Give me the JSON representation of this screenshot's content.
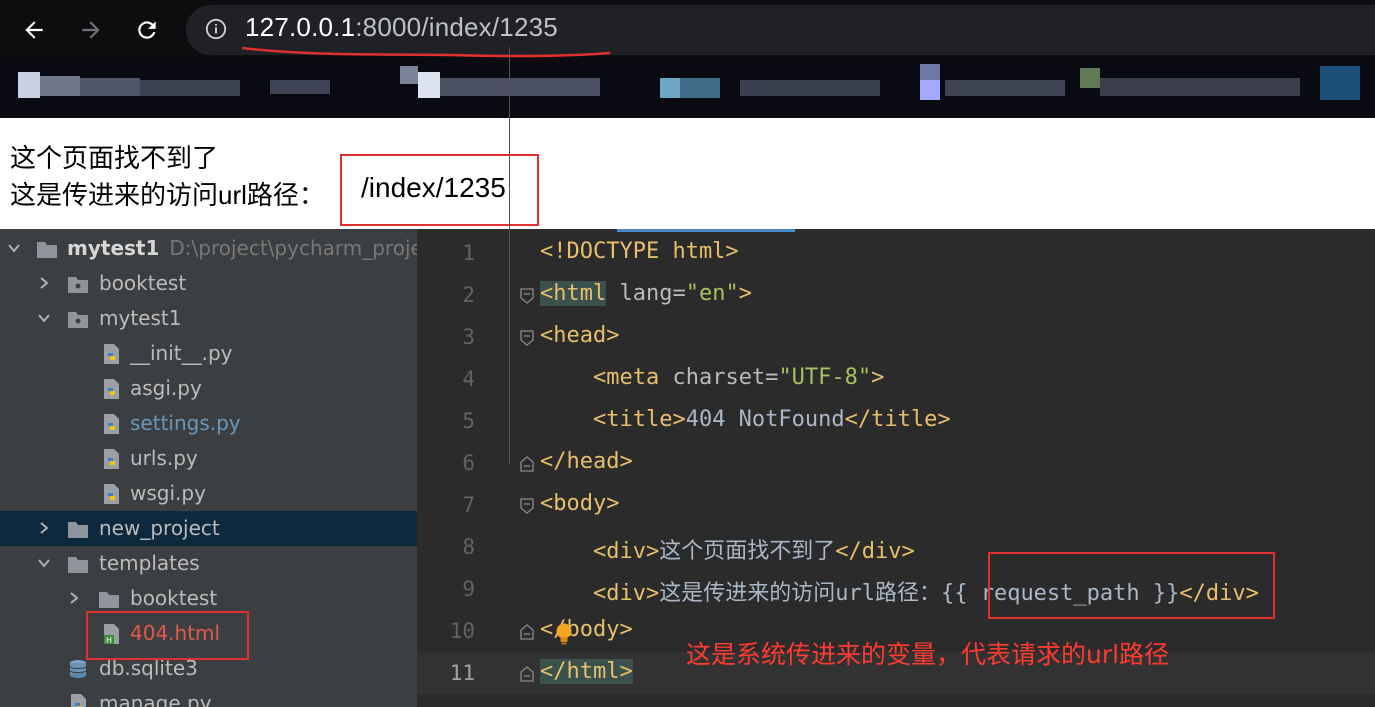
{
  "browser": {
    "url_host": "127.0.0.1",
    "url_rest": ":8000/index/1235",
    "colors": {
      "annotation": "#e0312f"
    }
  },
  "page": {
    "line1": "这个页面找不到了",
    "line2_prefix": "这是传进来的访问url路径：",
    "request_path": "/index/1235"
  },
  "project_tree": {
    "root": {
      "name": "mytest1",
      "path": "D:\\project\\pycharm_proje"
    },
    "items": [
      {
        "label": "booktest"
      },
      {
        "label": "mytest1"
      },
      {
        "label": "__init__.py"
      },
      {
        "label": "asgi.py"
      },
      {
        "label": "settings.py"
      },
      {
        "label": "urls.py"
      },
      {
        "label": "wsgi.py"
      },
      {
        "label": "new_project"
      },
      {
        "label": "templates"
      },
      {
        "label": "booktest"
      },
      {
        "label": "404.html"
      },
      {
        "label": "db.sqlite3"
      },
      {
        "label": "manage.py"
      }
    ]
  },
  "editor": {
    "line_numbers": [
      "1",
      "2",
      "3",
      "4",
      "5",
      "6",
      "7",
      "8",
      "9",
      "10",
      "11"
    ],
    "lines": {
      "l1": "<!DOCTYPE html>",
      "l2_open": "<html",
      "l2_attr": " lang=",
      "l2_val": "\"en\"",
      "l2_close": ">",
      "l3": "<head>",
      "l4_open": "<meta",
      "l4_attr": " charset=",
      "l4_val": "\"UTF-8\"",
      "l4_close": ">",
      "l5_open": "<title>",
      "l5_text": "404 NotFound",
      "l5_close": "</title>",
      "l6": "</head>",
      "l7": "<body>",
      "l8_open": "<div>",
      "l8_text": "这个页面找不到了",
      "l8_close": "</div>",
      "l9_open": "<div>",
      "l9_text": "这是传进来的访问url路径：",
      "l9_var": "{{ request_path }}",
      "l9_close": "</div>",
      "l10": "</body>",
      "l11": "</html>"
    }
  },
  "annotation": "这是系统传进来的变量，代表请求的url路径"
}
